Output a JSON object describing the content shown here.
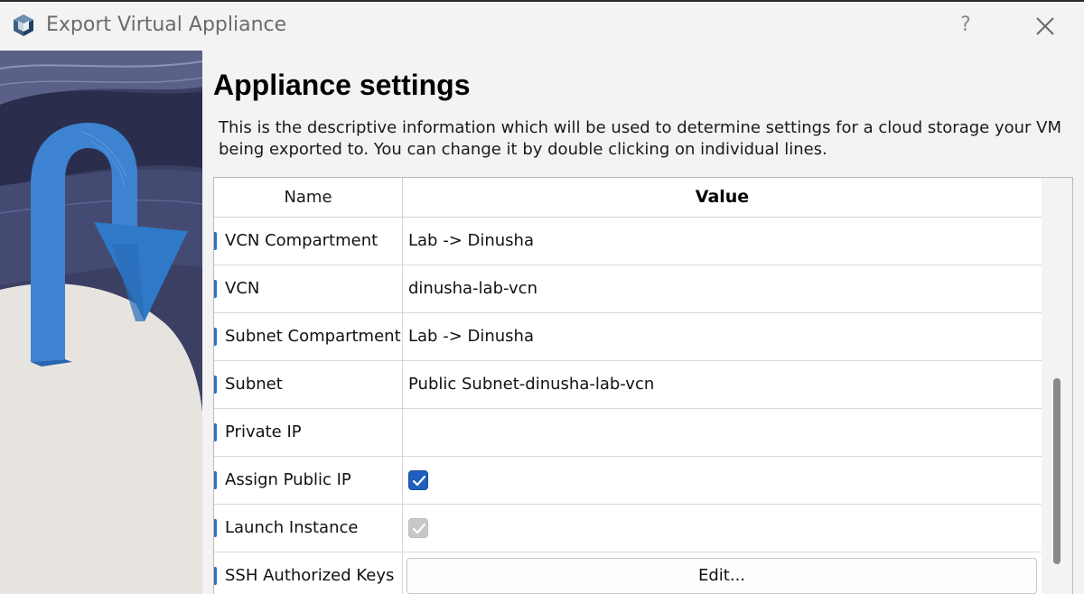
{
  "window": {
    "title": "Export Virtual Appliance",
    "help_label": "?"
  },
  "page": {
    "heading": "Appliance settings",
    "description": "This is the descriptive information which will be used to determine settings for a cloud storage your VM being exported to. You can change it by double clicking on individual lines."
  },
  "table": {
    "columns": {
      "name": "Name",
      "value": "Value"
    },
    "rows": [
      {
        "name": "VCN Compartment",
        "value": "Lab -> Dinusha"
      },
      {
        "name": "VCN",
        "value": "dinusha-lab-vcn"
      },
      {
        "name": "Subnet Compartment",
        "value": "Lab -> Dinusha"
      },
      {
        "name": "Subnet",
        "value": "Public Subnet-dinusha-lab-vcn"
      },
      {
        "name": "Private IP",
        "value": ""
      },
      {
        "name": "Assign Public IP",
        "checked": true
      },
      {
        "name": "Launch Instance",
        "checked": true,
        "disabled": true
      },
      {
        "name": "SSH Authorized Keys",
        "button_label": "Edit..."
      }
    ]
  },
  "colors": {
    "accent": "#1f5fbf",
    "background": "#f3f3f3"
  },
  "icons": {
    "app": "virtualbox-cube-icon",
    "close": "close-icon",
    "check": "checkmark-icon"
  }
}
